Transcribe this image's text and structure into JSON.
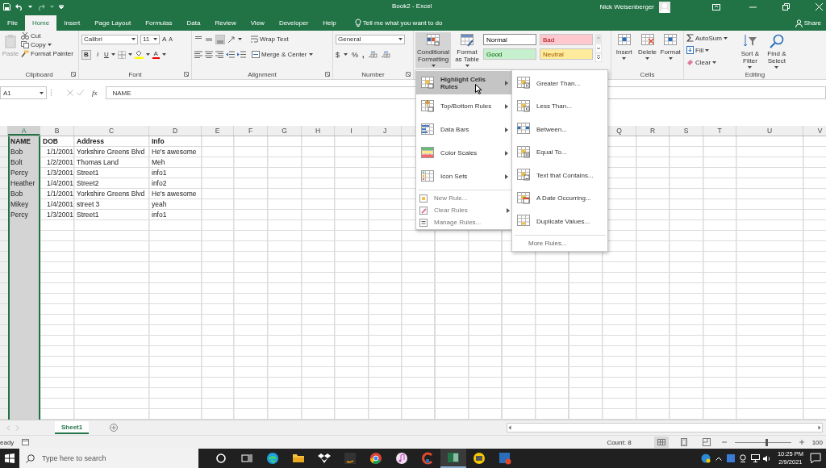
{
  "title_bar": {
    "title": "Book2  -  Excel",
    "user": "Nick Weisenberger"
  },
  "ribbon_tabs": [
    {
      "label": "File",
      "selected": false
    },
    {
      "label": "Home",
      "selected": true
    },
    {
      "label": "Insert",
      "selected": false
    },
    {
      "label": "Page Layout",
      "selected": false
    },
    {
      "label": "Formulas",
      "selected": false
    },
    {
      "label": "Data",
      "selected": false
    },
    {
      "label": "Review",
      "selected": false
    },
    {
      "label": "View",
      "selected": false
    },
    {
      "label": "Developer",
      "selected": false
    },
    {
      "label": "Help",
      "selected": false
    }
  ],
  "tell_me": {
    "placeholder": "Tell me what you want to do"
  },
  "share": "Share",
  "clipboard": {
    "paste": "Paste",
    "cut": "Cut",
    "copy": "Copy",
    "format_painter": "Format Painter",
    "label": "Clipboard"
  },
  "font": {
    "family": "Calibri",
    "size": "11",
    "grow": "A",
    "shrink": "A",
    "bold": "B",
    "italic": "I",
    "underline": "U",
    "font_color": "A",
    "label": "Font"
  },
  "alignment": {
    "wrap_text": "Wrap Text",
    "merge_center": "Merge & Center",
    "label": "Alignment"
  },
  "number": {
    "format": "General",
    "currency": "$",
    "percent": "%",
    "comma": ",",
    "label": "Number"
  },
  "styles": {
    "conditional_formatting": {
      "label": "Conditional Formatting",
      "pressed": true
    },
    "format_as_table": "Format as Table",
    "cell_styles": [
      {
        "label": "Normal",
        "kind": "normal"
      },
      {
        "label": "Bad",
        "kind": "bad"
      },
      {
        "label": "Good",
        "kind": "good"
      },
      {
        "label": "Neutral",
        "kind": "neutral"
      }
    ]
  },
  "cells_group": {
    "buttons": [
      "Insert",
      "Delete",
      "Format"
    ],
    "label": "Cells"
  },
  "editing": {
    "autosum": "AutoSum",
    "fill": "Fill",
    "clear": "Clear",
    "sort_filter": "Sort & Filter",
    "find_select": "Find & Select",
    "label": "Editing"
  },
  "formula_bar": {
    "name_box": "A1",
    "fx": "fx",
    "value": "NAME"
  },
  "sheet": {
    "columns": [
      {
        "label": "A",
        "selected": true
      },
      {
        "label": "B",
        "selected": false
      },
      {
        "label": "C",
        "selected": false
      },
      {
        "label": "D",
        "selected": false
      },
      {
        "label": "E",
        "selected": false
      },
      {
        "label": "F",
        "selected": false
      },
      {
        "label": "G",
        "selected": false
      },
      {
        "label": "H",
        "selected": false
      },
      {
        "label": "I",
        "selected": false
      },
      {
        "label": "J",
        "selected": false
      },
      {
        "label": "Q",
        "selected": false
      },
      {
        "label": "R",
        "selected": false
      },
      {
        "label": "S",
        "selected": false
      },
      {
        "label": "T",
        "selected": false
      },
      {
        "label": "U",
        "selected": false
      },
      {
        "label": "V",
        "selected": false
      }
    ],
    "rows": [
      [
        "NAME",
        "DOB",
        "Address",
        "Info"
      ],
      [
        "Bob",
        "1/1/2001",
        "Yorkshire Greens Blvd",
        "He's awesome"
      ],
      [
        "Bolt",
        "1/2/2001",
        "Thomas Land",
        "Meh"
      ],
      [
        "Percy",
        "1/3/2001",
        "Street1",
        "info1"
      ],
      [
        "Heather",
        "1/4/2001",
        "Street2",
        "info2"
      ],
      [
        "Bob",
        "1/1/2001",
        "Yorkshire Greens Blvd",
        "He's awesome"
      ],
      [
        "Mikey",
        "1/4/2001",
        "street 3",
        "yeah"
      ],
      [
        "Percy",
        "1/3/2001",
        "Street1",
        "info1"
      ]
    ]
  },
  "menu": {
    "items": [
      {
        "label": "Highlight Cells Rules",
        "kind": "large",
        "submenu": true,
        "selected": true
      },
      {
        "label": "Top/Bottom Rules",
        "kind": "large",
        "submenu": true,
        "selected": false
      },
      {
        "label": "Data Bars",
        "kind": "large",
        "submenu": true,
        "selected": false
      },
      {
        "label": "Color Scales",
        "kind": "large",
        "submenu": true,
        "selected": false
      },
      {
        "label": "Icon Sets",
        "kind": "large",
        "submenu": true,
        "selected": false
      },
      {
        "label": "New Rule...",
        "kind": "small",
        "submenu": false,
        "selected": false
      },
      {
        "label": "Clear Rules",
        "kind": "small",
        "submenu": true,
        "selected": false
      },
      {
        "label": "Manage Rules...",
        "kind": "small",
        "submenu": false,
        "selected": false
      }
    ]
  },
  "submenu": {
    "items": [
      "Greater Than...",
      "Less Than...",
      "Between...",
      "Equal To...",
      "Text that Contains...",
      "A Date Occurring...",
      "Duplicate Values..."
    ],
    "more": "More Rules..."
  },
  "sheet_tabs": [
    {
      "label": "Sheet1",
      "selected": true
    }
  ],
  "status_bar": {
    "status": "eady",
    "count": "Count: 8",
    "views": [
      {
        "selected": true
      },
      {
        "selected": false
      },
      {
        "selected": false
      }
    ],
    "zoom": {
      "level": 0.55,
      "reading": "100"
    }
  },
  "taskbar": {
    "search": {
      "placeholder": "Type here to search"
    },
    "time": "10:25 PM",
    "date": "2/9/2021"
  }
}
